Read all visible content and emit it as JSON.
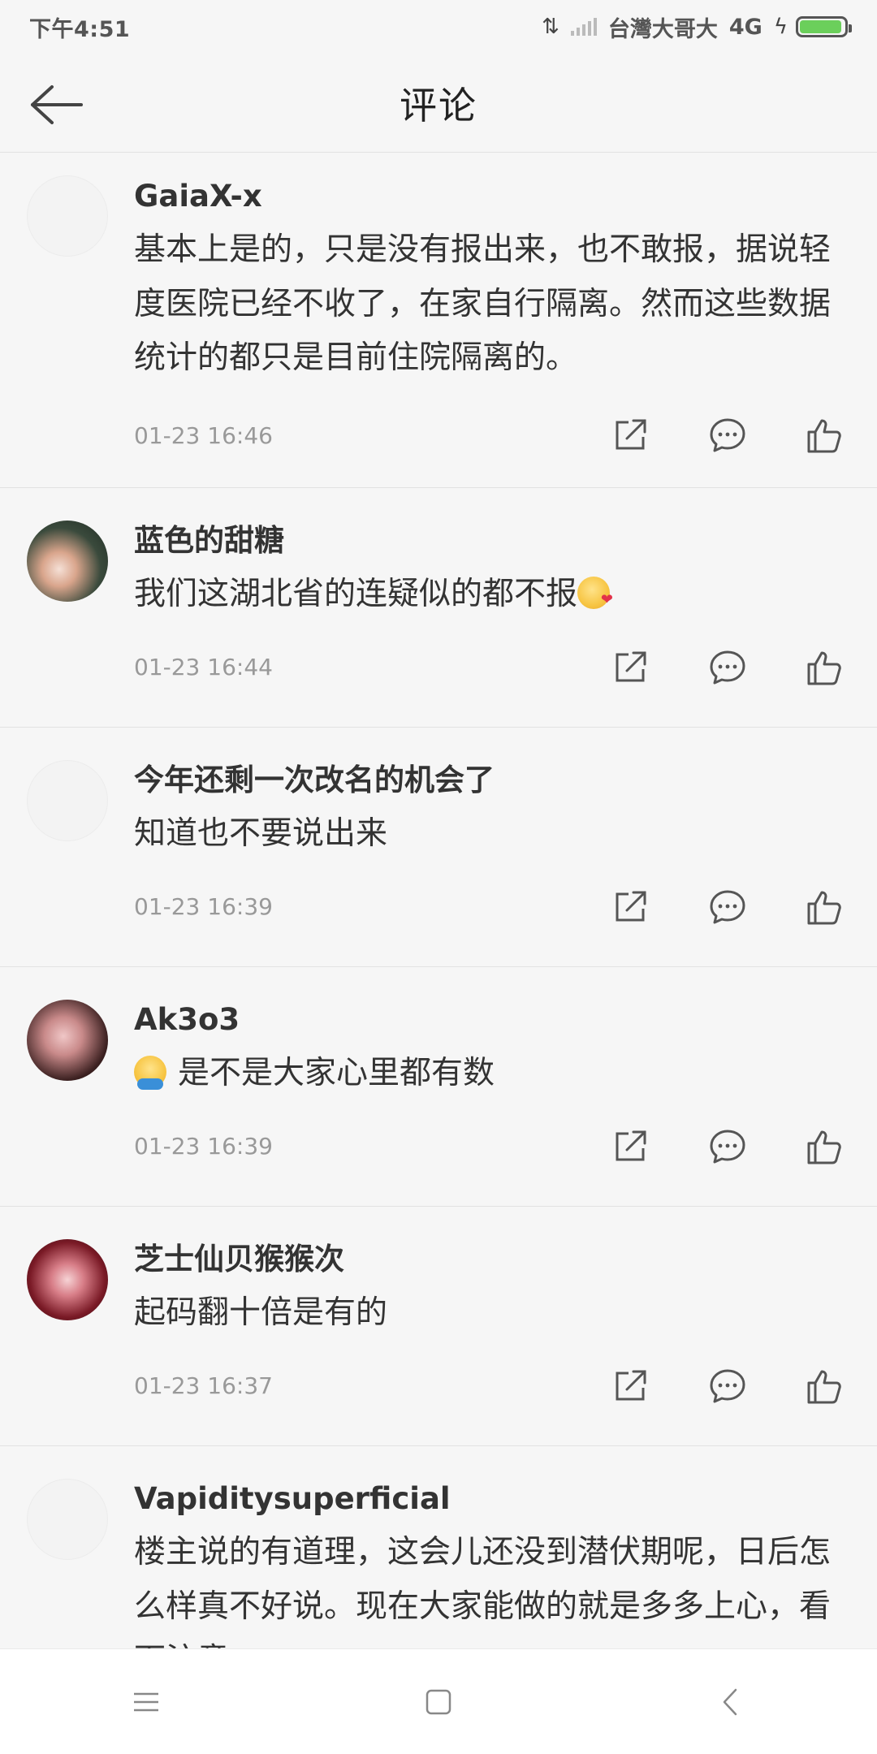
{
  "status_bar": {
    "time": "下午4:51",
    "carrier": "台灣大哥大",
    "network": "4G",
    "battery_level": 0.95
  },
  "header": {
    "title": "评论"
  },
  "comments": [
    {
      "username": "GaiaX-x",
      "text": "基本上是的，只是没有报出来，也不敢报，据说轻度医院已经不收了，在家自行隔离。然而这些数据统计的都只是目前住院隔离的。",
      "time": "01-23 16:46"
    },
    {
      "username": "蓝色的甜糖",
      "text": "我们这湖北省的连疑似的都不报",
      "time": "01-23 16:44"
    },
    {
      "username": "今年还剩一次改名的机会了",
      "text": "知道也不要说出来",
      "time": "01-23 16:39"
    },
    {
      "username": "Ak3o3",
      "text": "是不是大家心里都有数",
      "time": "01-23 16:39"
    },
    {
      "username": "芝士仙贝猴猴次",
      "text": "起码翻十倍是有的",
      "time": "01-23 16:37"
    },
    {
      "username": "Vapiditysuperficial",
      "text": "楼主说的有道理，这会儿还没到潜伏期呢，日后怎么样真不好说。现在大家能做的就是多多上心，看下注意"
    }
  ]
}
